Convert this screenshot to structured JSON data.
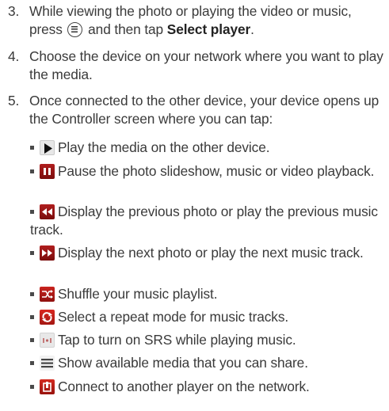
{
  "steps": [
    {
      "number": "3.",
      "text_before": "While viewing the photo or playing the video or music, press",
      "text_middle": "and then tap",
      "bold": "Select player",
      "text_after": "."
    },
    {
      "number": "4.",
      "text": "Choose the device on your network where you want to play the media."
    },
    {
      "number": "5.",
      "text": "Once connected to the other device, your device opens up the Controller screen where you can tap:"
    }
  ],
  "controls": [
    {
      "icon": "play-icon",
      "text": "Play the media on the other device."
    },
    {
      "icon": "pause-icon",
      "text": "Pause the photo slideshow, music or video playback."
    },
    {
      "icon": "previous-icon",
      "text": "Display the previous photo or play the previous music track."
    },
    {
      "icon": "next-icon",
      "text": "Display the next photo or play the next music track."
    },
    {
      "icon": "shuffle-icon",
      "text": "Shuffle your music playlist."
    },
    {
      "icon": "repeat-icon",
      "text": "Select a repeat mode for music tracks."
    },
    {
      "icon": "srs-icon",
      "text": "Tap to turn on SRS while playing music."
    },
    {
      "icon": "media-list-icon",
      "text": "Show available media that you can share."
    },
    {
      "icon": "connect-player-icon",
      "text": "Connect to another player on the network."
    }
  ],
  "colors": {
    "text": "#3a3a3a",
    "icon_red": "#b01e1e"
  }
}
